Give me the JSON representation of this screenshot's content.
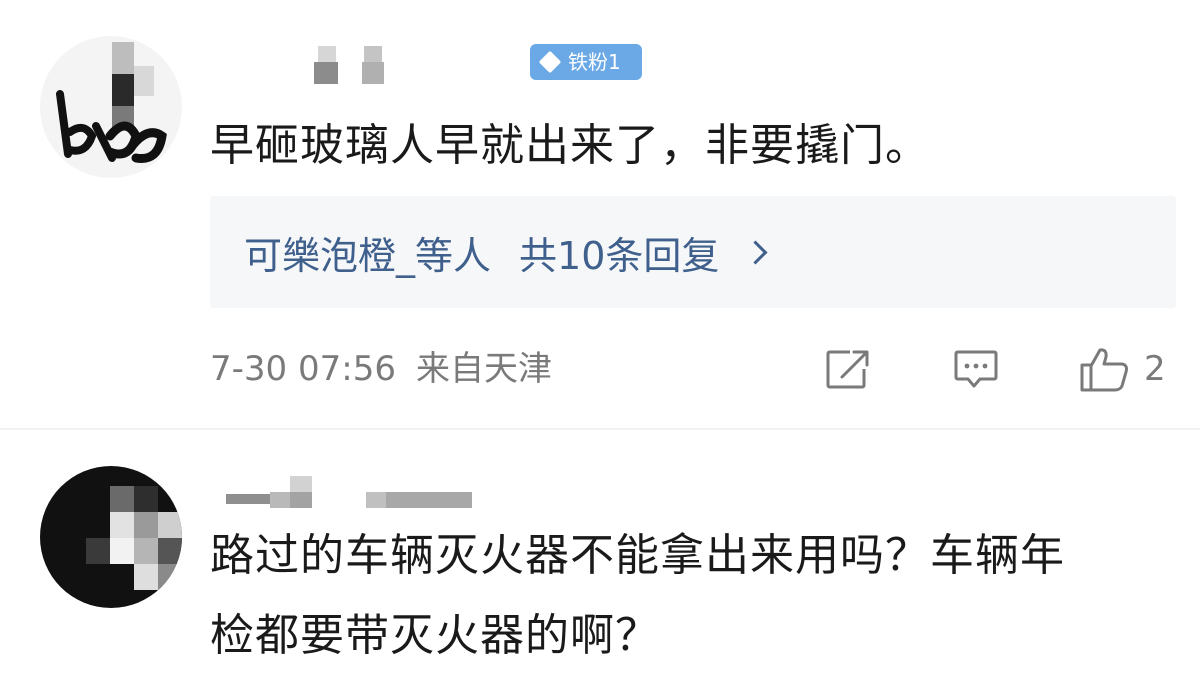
{
  "comments": [
    {
      "badge": "铁粉1",
      "text": "早砸玻璃人早就出来了，非要撬门。",
      "replies": {
        "users": "可樂泡橙_等人",
        "count_label": "共10条回复"
      },
      "timestamp": "7-30 07:56",
      "location": "来自天津",
      "like_count": "2"
    },
    {
      "text_line1": "路过的车辆灭火器不能拿出来用吗？车辆年",
      "text_line2": "检都要带灭火器的啊？"
    }
  ],
  "icons": {
    "badge": "diamond-icon",
    "share": "share-icon",
    "reply": "comment-icon",
    "like": "thumbs-up-icon",
    "more_replies": "chevron-right-icon"
  },
  "colors": {
    "link_blue": "#3f5f8c",
    "badge_blue": "#6aa8e6",
    "meta_gray": "#7a7a7a",
    "text_dark": "#1a1a1a",
    "reply_bg": "#f6f7f9"
  }
}
